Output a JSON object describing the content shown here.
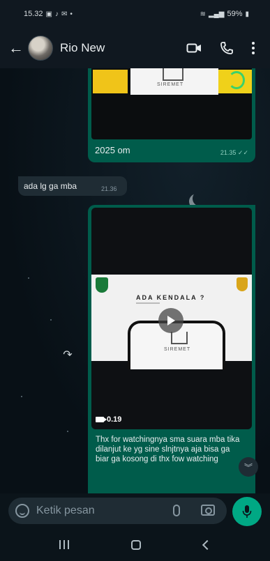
{
  "status_bar": {
    "time": "15.32",
    "notif_icons": [
      "gallery-icon",
      "tiktok-icon",
      "mail-icon",
      "dot-icon"
    ],
    "signal_label": "⚠︎ ≡ .∥",
    "battery": "59%"
  },
  "header": {
    "contact_name": "Rio New",
    "actions": [
      "video-call-icon",
      "voice-call-icon",
      "more-options-icon"
    ]
  },
  "messages": [
    {
      "direction": "out",
      "type": "image",
      "image_text": "SIREMET",
      "text": "2025 om",
      "time": "21.35",
      "status": "read"
    },
    {
      "direction": "in",
      "type": "text",
      "text": "ada lg ga mba",
      "time": "21.36"
    },
    {
      "direction": "out",
      "type": "video",
      "slide_title": "ADA KENDALA ?",
      "image_text": "SIREMET",
      "duration": "0.19",
      "caption": "Thx for watchingnya sma suara mba tika dilanjut ke yg sine slnjtnya aja bisa ga biar ga kosong di thx fow watching"
    }
  ],
  "composer": {
    "placeholder": "Ketik pesan"
  },
  "colors": {
    "outgoing_bubble": "#005c4b",
    "incoming_bubble": "#1f2c34",
    "accent": "#00a884",
    "background": "#0b141a"
  }
}
